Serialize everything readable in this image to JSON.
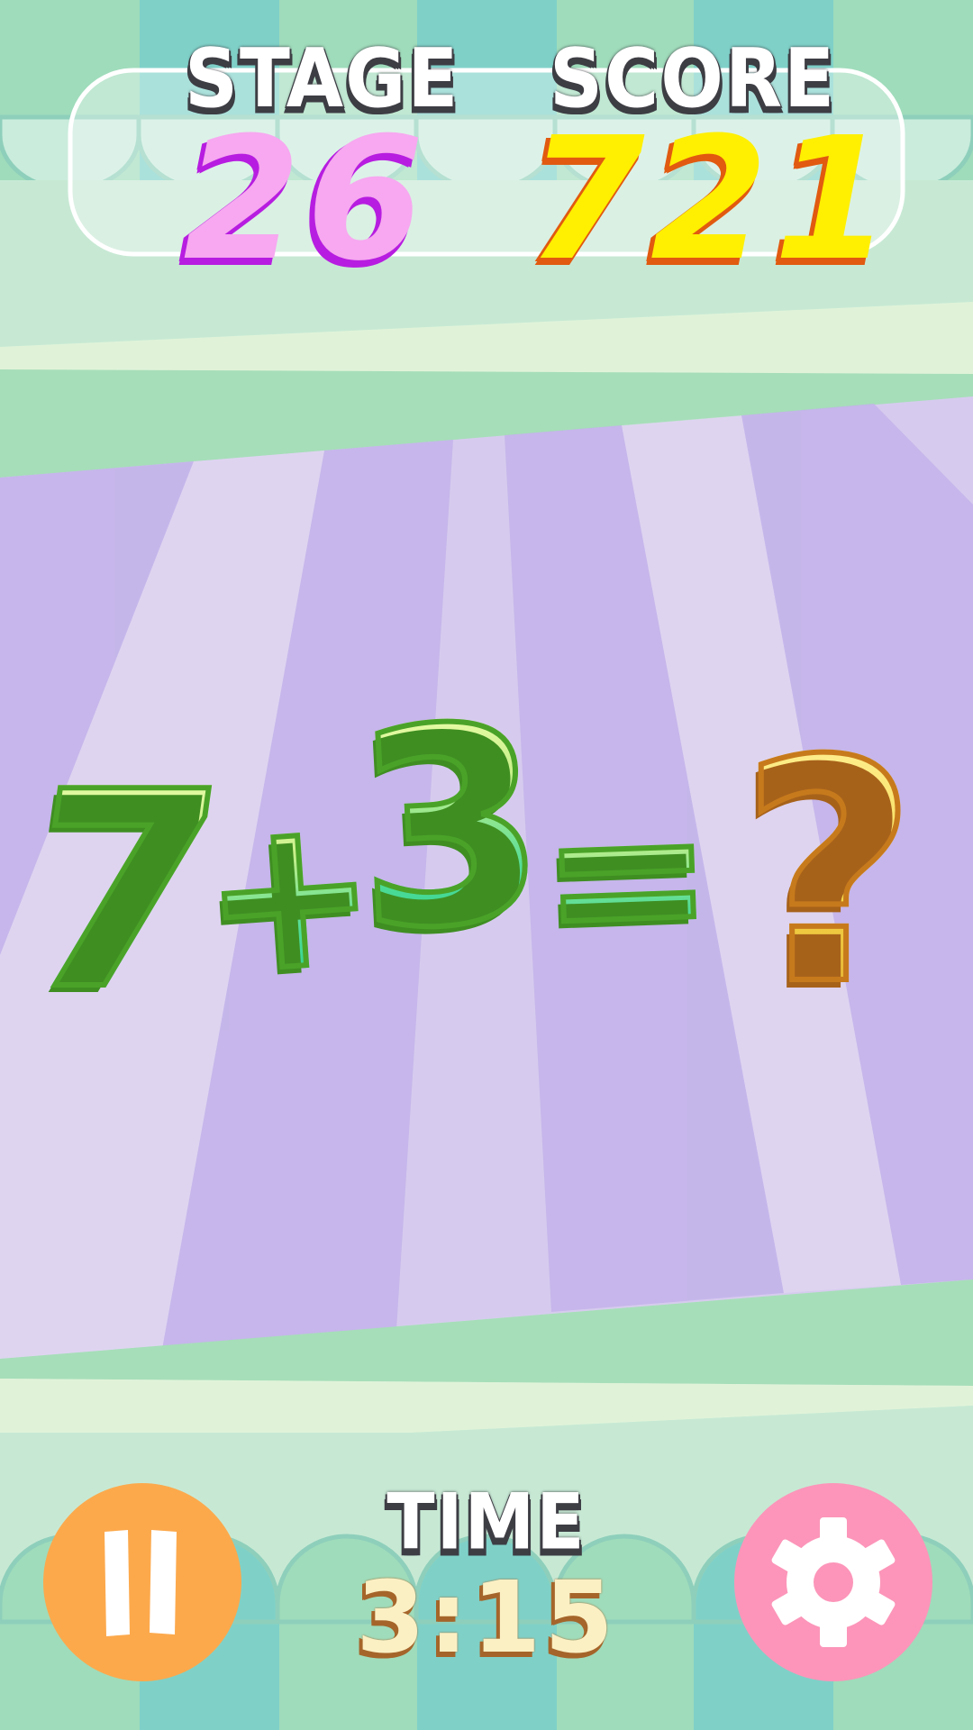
{
  "hud": {
    "stage_label": "STAGE",
    "stage_value": "26",
    "score_label": "SCORE",
    "score_value": "721",
    "time_label": "TIME",
    "time_value": "3:15"
  },
  "equation": {
    "operand_1": "7",
    "operator": "+",
    "operand_2": "3",
    "equals": "=",
    "answer": "?"
  },
  "buttons": {
    "pause_icon": "pause-icon",
    "settings_icon": "gear-icon"
  },
  "colors": {
    "stage_value": "#f7a8f0",
    "score_value": "#ffef00",
    "equation_green": "#2fd38f",
    "answer_gold": "#f5d84a",
    "pause_button": "#fca94c",
    "settings_button": "#fc95b9",
    "background_purple": "#cdbff0",
    "background_mint": "#a9dfbd"
  }
}
